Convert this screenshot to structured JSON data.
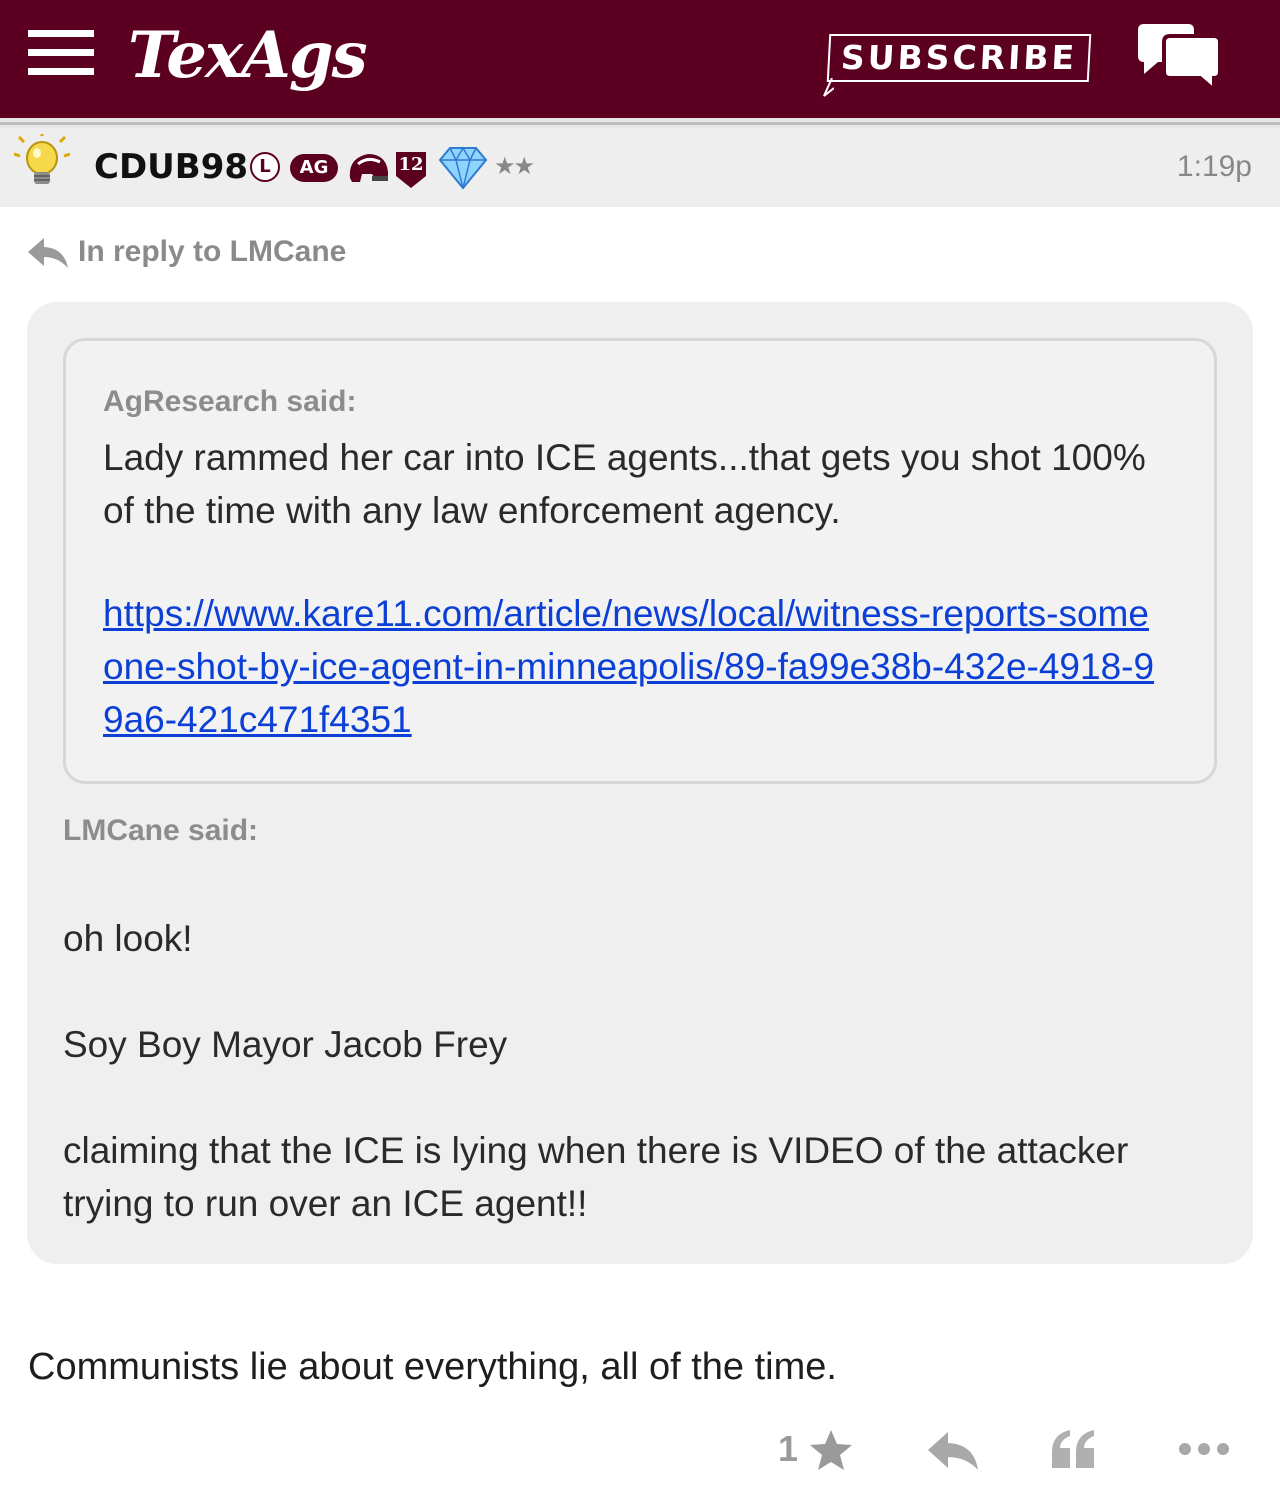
{
  "header": {
    "logo": "TexAgs",
    "subscribe_label": "SUBSCRIBE",
    "menu_icon": "hamburger-menu-icon",
    "chat_icon": "chat-bubbles-icon",
    "brand_color": "#5c0022"
  },
  "post": {
    "username": "CDUB98",
    "badges": {
      "l": "L",
      "ag": "AG",
      "number": "12",
      "stars": "★★"
    },
    "timestamp": "1:19p",
    "reply_to": "In reply to LMCane",
    "quote": {
      "inner": {
        "said": "AgResearch said:",
        "body": "Lady rammed her car into ICE agents...that gets you shot 100% of the time with any law enforcement agency.",
        "link": "https://www.kare11.com/article/news/local/witness-reports-someone-shot-by-ice-agent-in-minneapolis/89-fa99e38b-432e-4918-99a6-421c471f4351"
      },
      "outer": {
        "said": "LMCane said:",
        "p1": "oh look!",
        "p2": "Soy Boy Mayor Jacob Frey",
        "p3": "claiming that the ICE is lying when there is VIDEO of the attacker trying to run over an ICE agent!!"
      }
    },
    "body": "Communists lie about everything, all of the time.",
    "actions": {
      "like_count": "1"
    }
  }
}
